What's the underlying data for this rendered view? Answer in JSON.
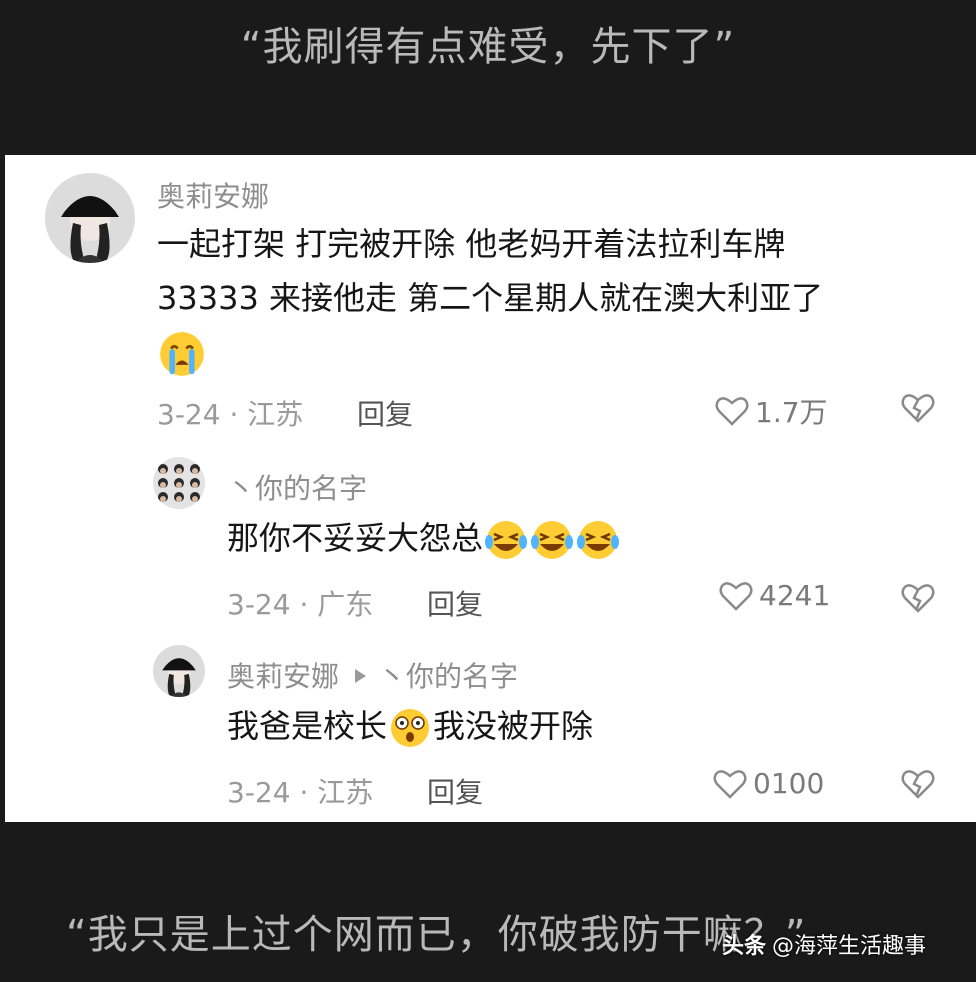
{
  "captions": {
    "top": "“我刷得有点难受，先下了”",
    "bottom": "“我只是上过个网而已，你破我防干嘛？”"
  },
  "comments": [
    {
      "user": "奥莉安娜",
      "text_line1": "一起打架 打完被开除 他老妈开着法拉利车牌",
      "text_line2": "33333 来接他走 第二个星期人就在澳大利亚了",
      "emoji": "crying-emoji",
      "date_loc": "3-24 · 江苏",
      "reply_label": "回复",
      "likes": "1.7万"
    },
    {
      "user": "丶你的名字",
      "text": "那你不妥妥大怨总",
      "emoji": "laughing-crying-emoji",
      "date_loc": "3-24 · 广东",
      "reply_label": "回复",
      "likes": "4241"
    },
    {
      "user": "奥莉安娜",
      "reply_to": "丶你的名字",
      "text_before": "我爸是校长",
      "emoji": "shocked-emoji",
      "text_after": "我没被开除",
      "date_loc": "3-24 · 江苏",
      "reply_label": "回复",
      "likes": "0100"
    }
  ],
  "watermark": {
    "brand": "头条",
    "handle": "@海萍生活趣事"
  },
  "colors": {
    "background": "#1a1a1a",
    "card": "#ffffff",
    "caption": "#b9b9b9",
    "meta": "#9a9a9a"
  }
}
